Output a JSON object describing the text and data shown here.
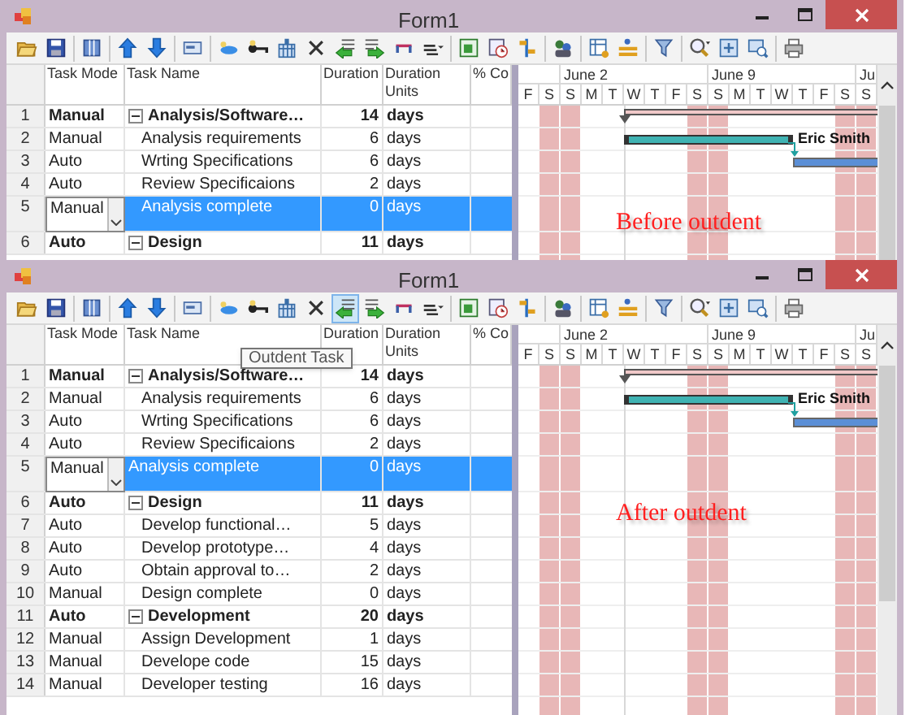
{
  "windows": [
    {
      "title": "Form1",
      "toolbar": [
        {
          "kind": "open",
          "hovered": false
        },
        {
          "kind": "save",
          "hovered": false
        },
        {
          "kind": "separator"
        },
        {
          "kind": "columns",
          "hovered": false
        },
        {
          "kind": "separator"
        },
        {
          "kind": "up",
          "hovered": false
        },
        {
          "kind": "down",
          "hovered": false
        },
        {
          "kind": "separator"
        },
        {
          "kind": "window",
          "hovered": false
        },
        {
          "kind": "separator"
        },
        {
          "kind": "tag",
          "hovered": false
        },
        {
          "kind": "key",
          "hovered": false
        },
        {
          "kind": "calendar",
          "hovered": false
        },
        {
          "kind": "delete",
          "hovered": false
        },
        {
          "kind": "outdent",
          "hovered": false
        },
        {
          "kind": "indent",
          "hovered": false
        },
        {
          "kind": "link",
          "hovered": false
        },
        {
          "kind": "menu",
          "hovered": false
        },
        {
          "kind": "separator"
        },
        {
          "kind": "sheet",
          "hovered": false
        },
        {
          "kind": "clock",
          "hovered": false
        },
        {
          "kind": "split",
          "hovered": false
        },
        {
          "kind": "separator"
        },
        {
          "kind": "people",
          "hovered": false
        },
        {
          "kind": "separator"
        },
        {
          "kind": "table",
          "hovered": false
        },
        {
          "kind": "level",
          "hovered": false
        },
        {
          "kind": "separator"
        },
        {
          "kind": "filter",
          "hovered": false
        },
        {
          "kind": "separator"
        },
        {
          "kind": "zoom",
          "hovered": false
        },
        {
          "kind": "fit",
          "hovered": false
        },
        {
          "kind": "zoomout",
          "hovered": false
        },
        {
          "kind": "separator"
        },
        {
          "kind": "print",
          "hovered": false
        }
      ],
      "columns": [
        "Task Mode",
        "Task Name",
        "Duration",
        "Duration Units",
        "% Co"
      ],
      "gantt": {
        "months": [
          "June 2",
          "June 9",
          "Ju"
        ],
        "days": [
          {
            "label": "F",
            "weekend": false
          },
          {
            "label": "S",
            "weekend": true
          },
          {
            "label": "S",
            "weekend": true
          },
          {
            "label": "M",
            "weekend": false
          },
          {
            "label": "T",
            "weekend": false
          },
          {
            "label": "W",
            "weekend": false
          },
          {
            "label": "T",
            "weekend": false
          },
          {
            "label": "F",
            "weekend": false
          },
          {
            "label": "S",
            "weekend": true
          },
          {
            "label": "S",
            "weekend": true
          },
          {
            "label": "M",
            "weekend": false
          },
          {
            "label": "T",
            "weekend": false
          },
          {
            "label": "W",
            "weekend": false
          },
          {
            "label": "T",
            "weekend": false
          },
          {
            "label": "F",
            "weekend": false
          },
          {
            "label": "S",
            "weekend": true
          },
          {
            "label": "S",
            "weekend": true
          }
        ]
      },
      "tasks": [
        {
          "row": "1",
          "mode": "Manual",
          "name": "Analysis/Software…",
          "duration": "14",
          "units": "days",
          "kind": "summary",
          "expanded": true,
          "selected": false,
          "editing": false,
          "gantt_bar": {
            "kind": "summary"
          },
          "children": [
            {
              "row": "2",
              "mode": "Manual",
              "name": "Analysis requirements",
              "duration": "6",
              "units": "days",
              "kind": "task",
              "selected": false,
              "editing": false,
              "gantt_bar": {
                "kind": "task"
              },
              "resource": "Eric Smith"
            },
            {
              "row": "3",
              "mode": "Auto",
              "name": "Wrting Specifications",
              "duration": "6",
              "units": "days",
              "kind": "task",
              "selected": false,
              "editing": false,
              "gantt_bar": {
                "kind": "linked_task"
              }
            },
            {
              "row": "4",
              "mode": "Auto",
              "name": "Review Specificaions",
              "duration": "2",
              "units": "days",
              "kind": "task",
              "selected": false,
              "editing": false
            },
            {
              "row": "5",
              "mode": "Manual",
              "name": "Analysis complete",
              "duration": "0",
              "units": "days",
              "kind": "task",
              "selected": true,
              "editing": true
            }
          ]
        },
        {
          "row": "6",
          "mode": "Auto",
          "name": "Design",
          "duration": "11",
          "units": "days",
          "kind": "summary",
          "expanded": true,
          "selected": false,
          "editing": false
        }
      ],
      "caption": "Before outdent"
    },
    {
      "title": "Form1",
      "toolbar": [
        {
          "kind": "open",
          "hovered": false
        },
        {
          "kind": "save",
          "hovered": false
        },
        {
          "kind": "separator"
        },
        {
          "kind": "columns",
          "hovered": false
        },
        {
          "kind": "separator"
        },
        {
          "kind": "up",
          "hovered": false
        },
        {
          "kind": "down",
          "hovered": false
        },
        {
          "kind": "separator"
        },
        {
          "kind": "window",
          "hovered": false
        },
        {
          "kind": "separator"
        },
        {
          "kind": "tag",
          "hovered": false
        },
        {
          "kind": "key",
          "hovered": false
        },
        {
          "kind": "calendar",
          "hovered": false
        },
        {
          "kind": "delete",
          "hovered": false
        },
        {
          "kind": "outdent",
          "hovered": true
        },
        {
          "kind": "indent",
          "hovered": false
        },
        {
          "kind": "link",
          "hovered": false
        },
        {
          "kind": "menu",
          "hovered": false
        },
        {
          "kind": "separator"
        },
        {
          "kind": "sheet",
          "hovered": false
        },
        {
          "kind": "clock",
          "hovered": false
        },
        {
          "kind": "split",
          "hovered": false
        },
        {
          "kind": "separator"
        },
        {
          "kind": "people",
          "hovered": false
        },
        {
          "kind": "separator"
        },
        {
          "kind": "table",
          "hovered": false
        },
        {
          "kind": "level",
          "hovered": false
        },
        {
          "kind": "separator"
        },
        {
          "kind": "filter",
          "hovered": false
        },
        {
          "kind": "separator"
        },
        {
          "kind": "zoom",
          "hovered": false
        },
        {
          "kind": "fit",
          "hovered": false
        },
        {
          "kind": "zoomout",
          "hovered": false
        },
        {
          "kind": "separator"
        },
        {
          "kind": "print",
          "hovered": false
        }
      ],
      "tooltip": "Outdent Task",
      "columns": [
        "Task Mode",
        "Task Name",
        "Duration",
        "Duration Units",
        "% Co"
      ],
      "gantt": {
        "months": [
          "June 2",
          "June 9",
          "Ju"
        ],
        "days": [
          {
            "label": "F",
            "weekend": false
          },
          {
            "label": "S",
            "weekend": true
          },
          {
            "label": "S",
            "weekend": true
          },
          {
            "label": "M",
            "weekend": false
          },
          {
            "label": "T",
            "weekend": false
          },
          {
            "label": "W",
            "weekend": false
          },
          {
            "label": "T",
            "weekend": false
          },
          {
            "label": "F",
            "weekend": false
          },
          {
            "label": "S",
            "weekend": true
          },
          {
            "label": "S",
            "weekend": true
          },
          {
            "label": "M",
            "weekend": false
          },
          {
            "label": "T",
            "weekend": false
          },
          {
            "label": "W",
            "weekend": false
          },
          {
            "label": "T",
            "weekend": false
          },
          {
            "label": "F",
            "weekend": false
          },
          {
            "label": "S",
            "weekend": true
          },
          {
            "label": "S",
            "weekend": true
          }
        ]
      },
      "tasks": [
        {
          "row": "1",
          "mode": "Manual",
          "name": "Analysis/Software…",
          "duration": "14",
          "units": "days",
          "kind": "summary",
          "expanded": true,
          "selected": false,
          "editing": false,
          "gantt_bar": {
            "kind": "summary"
          },
          "children": [
            {
              "row": "2",
              "mode": "Manual",
              "name": "Analysis requirements",
              "duration": "6",
              "units": "days",
              "kind": "task",
              "selected": false,
              "editing": false,
              "gantt_bar": {
                "kind": "task"
              },
              "resource": "Eric Smith"
            },
            {
              "row": "3",
              "mode": "Auto",
              "name": "Wrting Specifications",
              "duration": "6",
              "units": "days",
              "kind": "task",
              "selected": false,
              "editing": false,
              "gantt_bar": {
                "kind": "linked_task"
              }
            },
            {
              "row": "4",
              "mode": "Auto",
              "name": "Review Specificaions",
              "duration": "2",
              "units": "days",
              "kind": "task",
              "selected": false,
              "editing": false
            }
          ]
        },
        {
          "row": "5",
          "mode": "Manual",
          "name": "Analysis complete",
          "duration": "0",
          "units": "days",
          "kind": "task",
          "selected": true,
          "editing": true
        },
        {
          "row": "6",
          "mode": "Auto",
          "name": "Design",
          "duration": "11",
          "units": "days",
          "kind": "summary",
          "expanded": true,
          "selected": false,
          "editing": false,
          "children": [
            {
              "row": "7",
              "mode": "Auto",
              "name": "Develop functional…",
              "duration": "5",
              "units": "days",
              "kind": "task",
              "selected": false,
              "editing": false
            },
            {
              "row": "8",
              "mode": "Auto",
              "name": "Develop prototype…",
              "duration": "4",
              "units": "days",
              "kind": "task",
              "selected": false,
              "editing": false
            },
            {
              "row": "9",
              "mode": "Auto",
              "name": "Obtain approval to…",
              "duration": "2",
              "units": "days",
              "kind": "task",
              "selected": false,
              "editing": false
            },
            {
              "row": "10",
              "mode": "Manual",
              "name": "Design complete",
              "duration": "0",
              "units": "days",
              "kind": "task",
              "selected": false,
              "editing": false
            }
          ]
        },
        {
          "row": "11",
          "mode": "Auto",
          "name": "Development",
          "duration": "20",
          "units": "days",
          "kind": "summary",
          "expanded": true,
          "selected": false,
          "editing": false,
          "children": [
            {
              "row": "12",
              "mode": "Manual",
              "name": "Assign Development",
              "duration": "1",
              "units": "days",
              "kind": "task",
              "selected": false,
              "editing": false
            },
            {
              "row": "13",
              "mode": "Manual",
              "name": "Develope code",
              "duration": "15",
              "units": "days",
              "kind": "task",
              "selected": false,
              "editing": false
            },
            {
              "row": "14",
              "mode": "Manual",
              "name": "Developer testing",
              "duration": "16",
              "units": "days",
              "kind": "task",
              "selected": false,
              "editing": false
            }
          ]
        }
      ],
      "caption": "After outdent"
    }
  ]
}
